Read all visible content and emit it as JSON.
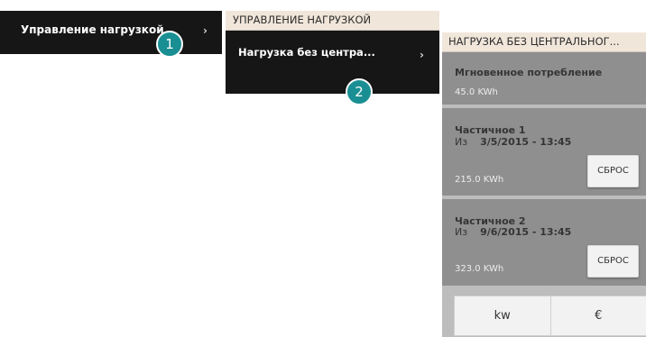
{
  "panel1": {
    "label": "Управление нагрузкой",
    "chevron": "›",
    "badge": "1"
  },
  "panel2": {
    "header": "УПРАВЛЕНИЕ НАГРУЗКОЙ",
    "item_label": "Нагрузка без центра...",
    "chevron": "›",
    "badge": "2"
  },
  "panel3": {
    "header": "НАГРУЗКА БЕЗ ЦЕНТРАЛЬНОГ...",
    "instant": {
      "title": "Мгновенное потребление",
      "value": "45.0 KWh"
    },
    "partial1": {
      "title": "Частичное 1",
      "from_label": "Из",
      "date": "3/5/2015 - 13:45",
      "value": "215.0 KWh",
      "reset_label": "СБРОС"
    },
    "partial2": {
      "title": "Частичное 2",
      "from_label": "Из",
      "date": "9/6/2015 - 13:45",
      "value": "323.0 KWh",
      "reset_label": "СБРОС"
    },
    "units": {
      "kw_label": "kw",
      "euro_label": "€"
    }
  },
  "colors": {
    "dark_bg": "#161616",
    "header_bg": "#f1e6da",
    "section_bg": "#8f8f8f",
    "badge": "#1a8f93"
  }
}
